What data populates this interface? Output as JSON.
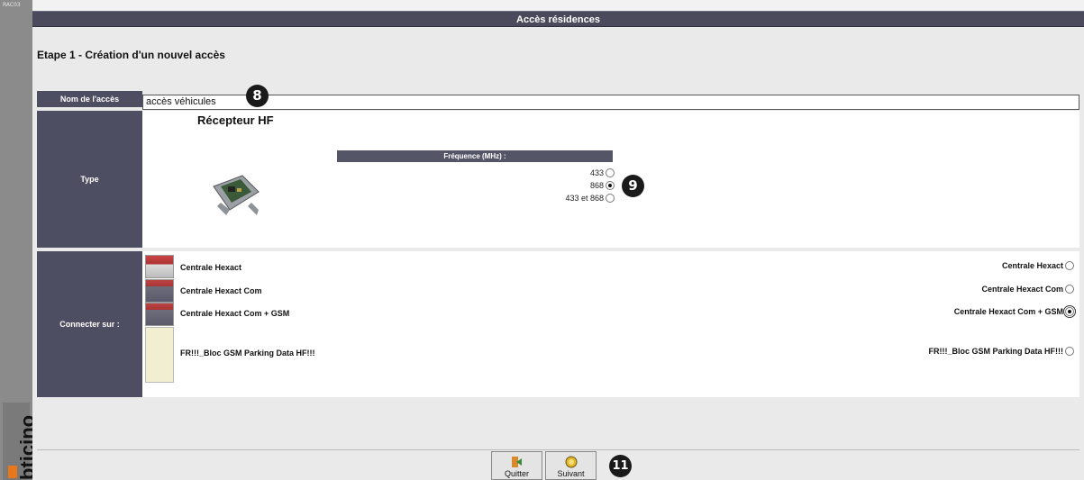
{
  "app": {
    "code": "RAC03",
    "brand": "bticino"
  },
  "window": {
    "title": "Accès résidences"
  },
  "step": {
    "title": "Etape 1 - Création d'un nouvel accès"
  },
  "form": {
    "name": {
      "label": "Nom de l'accès",
      "value": "accès véhicules"
    },
    "type": {
      "label": "Type",
      "receiver_title": "Récepteur HF",
      "frequency_header": "Fréquence (MHz) :",
      "options": [
        {
          "label": "433",
          "selected": false
        },
        {
          "label": "868",
          "selected": true
        },
        {
          "label": "433 et 868",
          "selected": false
        }
      ]
    },
    "connect": {
      "label": "Connecter sur :",
      "items": [
        {
          "left": "Centrale Hexact",
          "right": "Centrale Hexact",
          "selected": false
        },
        {
          "left": "Centrale Hexact Com",
          "right": "Centrale Hexact Com",
          "selected": false
        },
        {
          "left": "Centrale Hexact Com + GSM",
          "right": "Centrale Hexact Com + GSM",
          "selected": true
        },
        {
          "left": "FR!!!_Bloc GSM Parking Data HF!!!",
          "right": "FR!!!_Bloc GSM Parking Data HF!!!",
          "selected": false
        }
      ]
    }
  },
  "buttons": {
    "quit": "Quitter",
    "next": "Suivant"
  },
  "callouts": {
    "c8": "8",
    "c9": "9",
    "c11": "11"
  },
  "colors": {
    "header": "#4a4a5c",
    "label_bg": "#4e4e62",
    "brand_orange": "#e8761a"
  }
}
